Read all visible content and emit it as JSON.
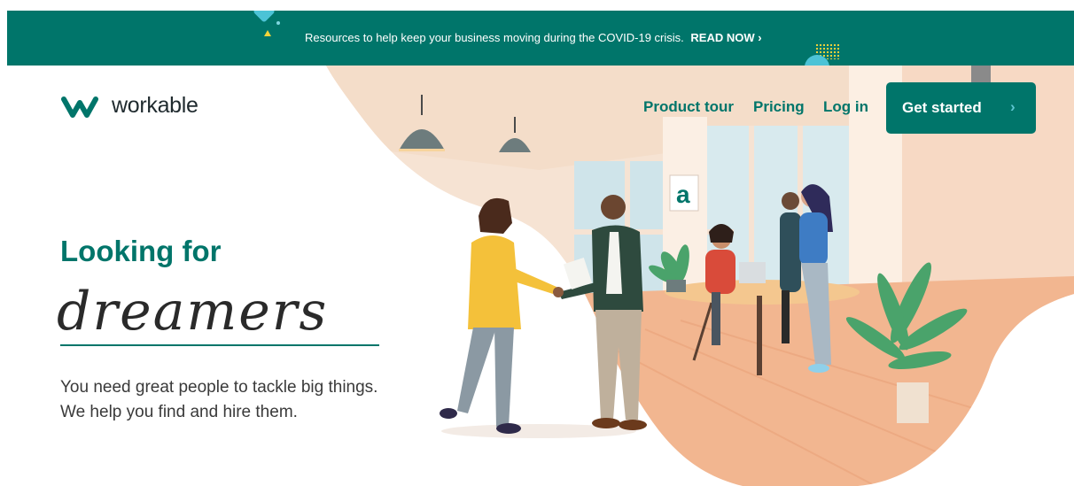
{
  "banner": {
    "message": "Resources to help keep your business moving during the COVID-19 crisis.",
    "link_label": "READ NOW ›"
  },
  "header": {
    "logo_text": "workable",
    "nav": {
      "product_tour": "Product tour",
      "pricing": "Pricing",
      "login": "Log in"
    },
    "cta_label": "Get started",
    "cta_chevron": "›"
  },
  "hero": {
    "title": "Looking for",
    "script_word": "dreamers",
    "description_line1": "You need great people to tackle big things.",
    "description_line2": "We help you find and hire them."
  },
  "illustration": {
    "wall_sign": "a"
  },
  "colors": {
    "brand_green": "#00756a",
    "accent_teal": "#4cc3d6",
    "accent_yellow": "#f4d43a",
    "floor": "#f2b690"
  }
}
